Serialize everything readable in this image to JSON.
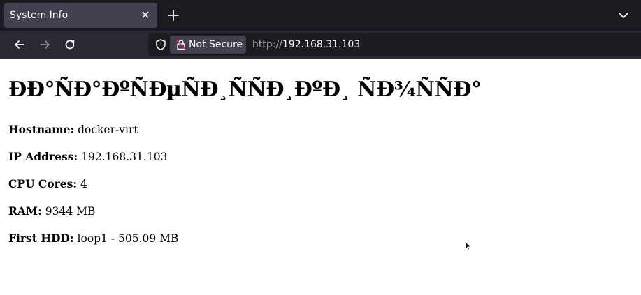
{
  "browser": {
    "tab": {
      "title": "System Info",
      "close_glyph": "✕"
    },
    "nav": {
      "back_icon": "arrow-left",
      "forward_icon": "arrow-right",
      "reload_icon": "reload",
      "new_tab_icon": "plus",
      "tab_list_icon": "chevron-down"
    },
    "url_bar": {
      "security_label": "Not Secure",
      "url_scheme": "http://",
      "url_host": "192.168.31.103"
    },
    "colors": {
      "tabstrip_bg": "#1c1b22",
      "toolbar_bg": "#2b2a33",
      "active_tab_bg": "#42414d",
      "text_light": "#fbfbfe",
      "text_dim": "#a8a7ae",
      "lock_strike": "#e22850"
    }
  },
  "page": {
    "heading": "ÐÐ°ÑÐ°ÐºÑÐµÑÐ¸ÑÑÐ¸ÐºÐ¸ ÑÐ¾ÑÑÐ°",
    "rows": [
      {
        "label": "Hostname:",
        "value": "docker-virt"
      },
      {
        "label": "IP Address:",
        "value": "192.168.31.103"
      },
      {
        "label": "CPU Cores:",
        "value": "4"
      },
      {
        "label": "RAM:",
        "value": "9344 MB"
      },
      {
        "label": "First HDD:",
        "value": "loop1 - 505.09 MB"
      }
    ]
  }
}
